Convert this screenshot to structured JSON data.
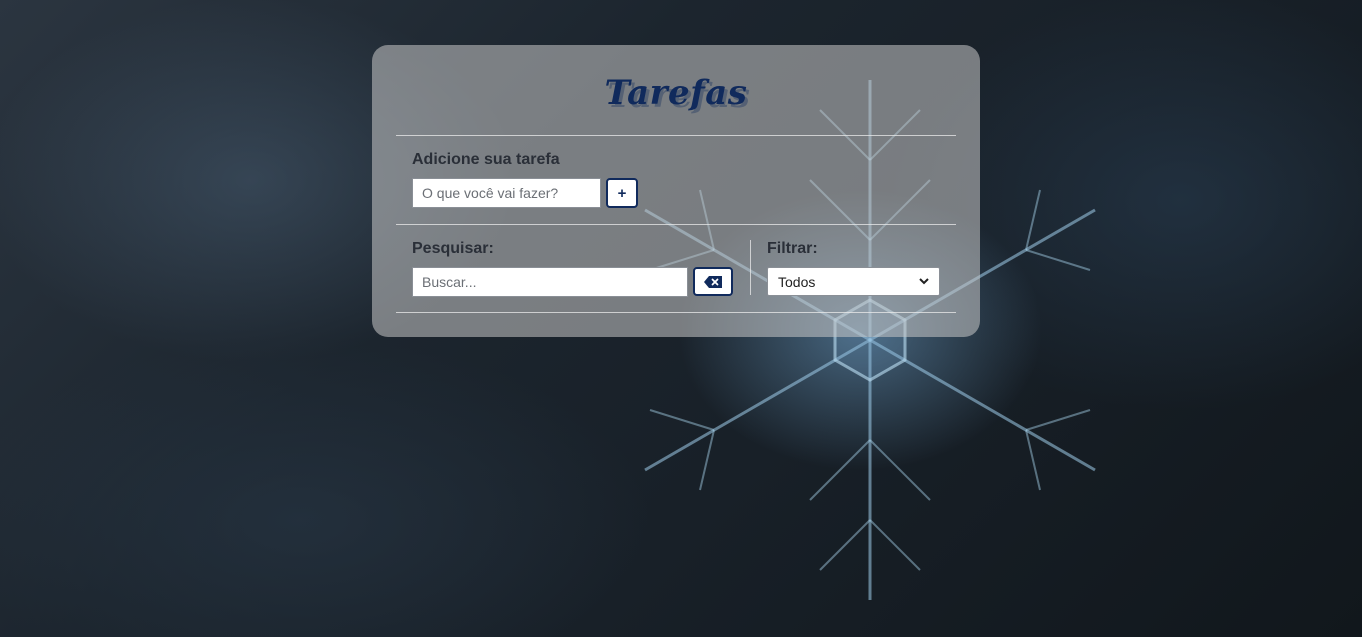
{
  "app": {
    "title": "Tarefas"
  },
  "add_task": {
    "label": "Adicione sua tarefa",
    "input_placeholder": "O que você vai fazer?",
    "input_value": "",
    "add_button_label": "+"
  },
  "search": {
    "label": "Pesquisar:",
    "input_placeholder": "Buscar...",
    "input_value": "",
    "clear_icon": "backspace-icon"
  },
  "filter": {
    "label": "Filtrar:",
    "selected": "Todos",
    "chevron_icon": "chevron-down-icon"
  },
  "colors": {
    "accent": "#102a5c",
    "card_background": "rgba(200,200,200,0.55)"
  }
}
